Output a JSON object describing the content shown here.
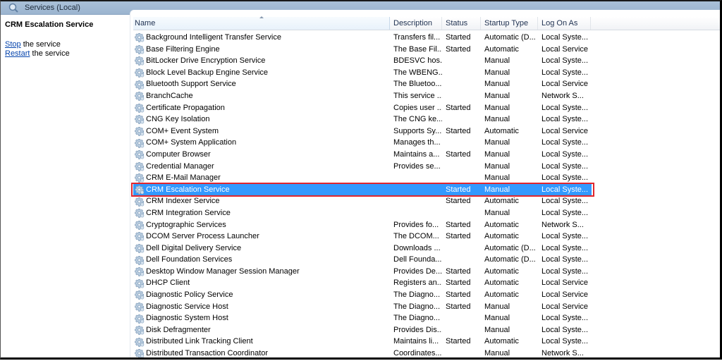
{
  "window": {
    "title": "Services (Local)",
    "title_icon": "services-magnifier-icon"
  },
  "left_pane": {
    "service_title": "CRM Escalation Service",
    "actions": [
      {
        "link": "Stop",
        "rest": " the service"
      },
      {
        "link": "Restart",
        "rest": " the service"
      }
    ]
  },
  "table": {
    "columns": [
      "Name",
      "Description",
      "Status",
      "Startup Type",
      "Log On As"
    ],
    "sorted_column": "Name",
    "row_icon": "gear-icon",
    "selected_index": 13,
    "rows": [
      {
        "name": "Background Intelligent Transfer Service",
        "description": "Transfers fil...",
        "status": "Started",
        "startup": "Automatic (D...",
        "logon": "Local Syste..."
      },
      {
        "name": "Base Filtering Engine",
        "description": "The Base Fil...",
        "status": "Started",
        "startup": "Automatic",
        "logon": "Local Service"
      },
      {
        "name": "BitLocker Drive Encryption Service",
        "description": "BDESVC hos...",
        "status": "",
        "startup": "Manual",
        "logon": "Local Syste..."
      },
      {
        "name": "Block Level Backup Engine Service",
        "description": "The WBENG...",
        "status": "",
        "startup": "Manual",
        "logon": "Local Syste..."
      },
      {
        "name": "Bluetooth Support Service",
        "description": "The Bluetoo...",
        "status": "",
        "startup": "Manual",
        "logon": "Local Service"
      },
      {
        "name": "BranchCache",
        "description": "This service ...",
        "status": "",
        "startup": "Manual",
        "logon": "Network S..."
      },
      {
        "name": "Certificate Propagation",
        "description": "Copies user ...",
        "status": "Started",
        "startup": "Manual",
        "logon": "Local Syste..."
      },
      {
        "name": "CNG Key Isolation",
        "description": "The CNG ke...",
        "status": "",
        "startup": "Manual",
        "logon": "Local Syste..."
      },
      {
        "name": "COM+ Event System",
        "description": "Supports Sy...",
        "status": "Started",
        "startup": "Automatic",
        "logon": "Local Service"
      },
      {
        "name": "COM+ System Application",
        "description": "Manages th...",
        "status": "",
        "startup": "Manual",
        "logon": "Local Syste..."
      },
      {
        "name": "Computer Browser",
        "description": "Maintains a...",
        "status": "Started",
        "startup": "Manual",
        "logon": "Local Syste..."
      },
      {
        "name": "Credential Manager",
        "description": "Provides se...",
        "status": "",
        "startup": "Manual",
        "logon": "Local Syste..."
      },
      {
        "name": "CRM E-Mail Manager",
        "description": "",
        "status": "",
        "startup": "Manual",
        "logon": "Local Syste..."
      },
      {
        "name": "CRM Escalation Service",
        "description": "",
        "status": "Started",
        "startup": "Manual",
        "logon": "Local Syste..."
      },
      {
        "name": "CRM Indexer Service",
        "description": "",
        "status": "Started",
        "startup": "Automatic",
        "logon": "Local Syste..."
      },
      {
        "name": "CRM Integration Service",
        "description": "",
        "status": "",
        "startup": "Manual",
        "logon": "Local Syste..."
      },
      {
        "name": "Cryptographic Services",
        "description": "Provides fo...",
        "status": "Started",
        "startup": "Automatic",
        "logon": "Network S..."
      },
      {
        "name": "DCOM Server Process Launcher",
        "description": "The DCOM...",
        "status": "Started",
        "startup": "Automatic",
        "logon": "Local Syste..."
      },
      {
        "name": "Dell Digital Delivery Service",
        "description": "Downloads ...",
        "status": "",
        "startup": "Automatic (D...",
        "logon": "Local Syste..."
      },
      {
        "name": "Dell Foundation Services",
        "description": "Dell Founda...",
        "status": "",
        "startup": "Automatic (D...",
        "logon": "Local Syste..."
      },
      {
        "name": "Desktop Window Manager Session Manager",
        "description": "Provides De...",
        "status": "Started",
        "startup": "Automatic",
        "logon": "Local Syste..."
      },
      {
        "name": "DHCP Client",
        "description": "Registers an...",
        "status": "Started",
        "startup": "Automatic",
        "logon": "Local Service"
      },
      {
        "name": "Diagnostic Policy Service",
        "description": "The Diagno...",
        "status": "Started",
        "startup": "Automatic",
        "logon": "Local Service"
      },
      {
        "name": "Diagnostic Service Host",
        "description": "The Diagno...",
        "status": "Started",
        "startup": "Manual",
        "logon": "Local Service"
      },
      {
        "name": "Diagnostic System Host",
        "description": "The Diagno...",
        "status": "",
        "startup": "Manual",
        "logon": "Local Syste..."
      },
      {
        "name": "Disk Defragmenter",
        "description": "Provides Dis...",
        "status": "",
        "startup": "Manual",
        "logon": "Local Syste..."
      },
      {
        "name": "Distributed Link Tracking Client",
        "description": "Maintains li...",
        "status": "Started",
        "startup": "Automatic",
        "logon": "Local Syste..."
      },
      {
        "name": "Distributed Transaction Coordinator",
        "description": "Coordinates...",
        "status": "",
        "startup": "Manual",
        "logon": "Network S..."
      }
    ]
  },
  "colors": {
    "titlebar": "#9bb4cf",
    "selection": "#3399ff",
    "highlight_border": "#e0262e",
    "link": "#0645ad"
  }
}
